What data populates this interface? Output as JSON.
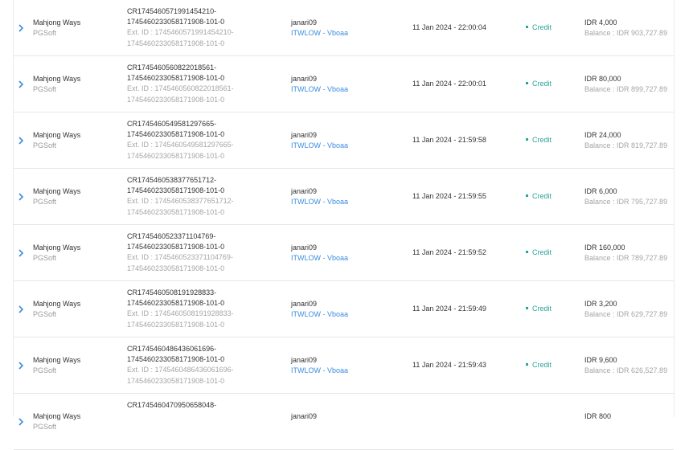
{
  "rows": [
    {
      "game": "Mahjong Ways",
      "provider": "PGSoft",
      "txn_l1": "CR1745460571991454210-",
      "txn_l2": "1745460233058171908-101-0",
      "ext_l1": "Ext. ID : 1745460571991454210-",
      "ext_l2": "1745460233058171908-101-0",
      "user": "janari09",
      "agent": "ITWLOW - Vboaa",
      "date": "11 Jan 2024 - 22:00:04",
      "type": "Credit",
      "amount": "IDR 4,000",
      "balance": "Balance : IDR 903,727.89"
    },
    {
      "game": "Mahjong Ways",
      "provider": "PGSoft",
      "txn_l1": "CR1745460560822018561-",
      "txn_l2": "1745460233058171908-101-0",
      "ext_l1": "Ext. ID : 1745460560822018561-",
      "ext_l2": "1745460233058171908-101-0",
      "user": "janari09",
      "agent": "ITWLOW - Vboaa",
      "date": "11 Jan 2024 - 22:00:01",
      "type": "Credit",
      "amount": "IDR 80,000",
      "balance": "Balance : IDR 899,727.89"
    },
    {
      "game": "Mahjong Ways",
      "provider": "PGSoft",
      "txn_l1": "CR1745460549581297665-",
      "txn_l2": "1745460233058171908-101-0",
      "ext_l1": "Ext. ID : 1745460549581297665-",
      "ext_l2": "1745460233058171908-101-0",
      "user": "janari09",
      "agent": "ITWLOW - Vboaa",
      "date": "11 Jan 2024 - 21:59:58",
      "type": "Credit",
      "amount": "IDR 24,000",
      "balance": "Balance : IDR 819,727.89"
    },
    {
      "game": "Mahjong Ways",
      "provider": "PGSoft",
      "txn_l1": "CR1745460538377651712-",
      "txn_l2": "1745460233058171908-101-0",
      "ext_l1": "Ext. ID : 1745460538377651712-",
      "ext_l2": "1745460233058171908-101-0",
      "user": "janari09",
      "agent": "ITWLOW - Vboaa",
      "date": "11 Jan 2024 - 21:59:55",
      "type": "Credit",
      "amount": "IDR 6,000",
      "balance": "Balance : IDR 795,727.89"
    },
    {
      "game": "Mahjong Ways",
      "provider": "PGSoft",
      "txn_l1": "CR1745460523371104769-",
      "txn_l2": "1745460233058171908-101-0",
      "ext_l1": "Ext. ID : 1745460523371104769-",
      "ext_l2": "1745460233058171908-101-0",
      "user": "janari09",
      "agent": "ITWLOW - Vboaa",
      "date": "11 Jan 2024 - 21:59:52",
      "type": "Credit",
      "amount": "IDR 160,000",
      "balance": "Balance : IDR 789,727.89"
    },
    {
      "game": "Mahjong Ways",
      "provider": "PGSoft",
      "txn_l1": "CR1745460508191928833-",
      "txn_l2": "1745460233058171908-101-0",
      "ext_l1": "Ext. ID : 1745460508191928833-",
      "ext_l2": "1745460233058171908-101-0",
      "user": "janari09",
      "agent": "ITWLOW - Vboaa",
      "date": "11 Jan 2024 - 21:59:49",
      "type": "Credit",
      "amount": "IDR 3,200",
      "balance": "Balance : IDR 629,727.89"
    },
    {
      "game": "Mahjong Ways",
      "provider": "PGSoft",
      "txn_l1": "CR1745460486436061696-",
      "txn_l2": "1745460233058171908-101-0",
      "ext_l1": "Ext. ID : 1745460486436061696-",
      "ext_l2": "1745460233058171908-101-0",
      "user": "janari09",
      "agent": "ITWLOW - Vboaa",
      "date": "11 Jan 2024 - 21:59:43",
      "type": "Credit",
      "amount": "IDR 9,600",
      "balance": "Balance : IDR 626,527.89"
    },
    {
      "game": "Mahjong Ways",
      "provider": "PGSoft",
      "txn_l1": "CR1745460470950658048-",
      "txn_l2": "",
      "ext_l1": "",
      "ext_l2": "",
      "user": "janari09",
      "agent": "",
      "date": "",
      "type": "",
      "amount": "IDR 800",
      "balance": ""
    }
  ],
  "colors": {
    "accent": "#3a8de0",
    "credit": "#2aa39b",
    "muted": "#a5a5a5"
  },
  "icons": {
    "expand": "chevron-right-icon"
  }
}
